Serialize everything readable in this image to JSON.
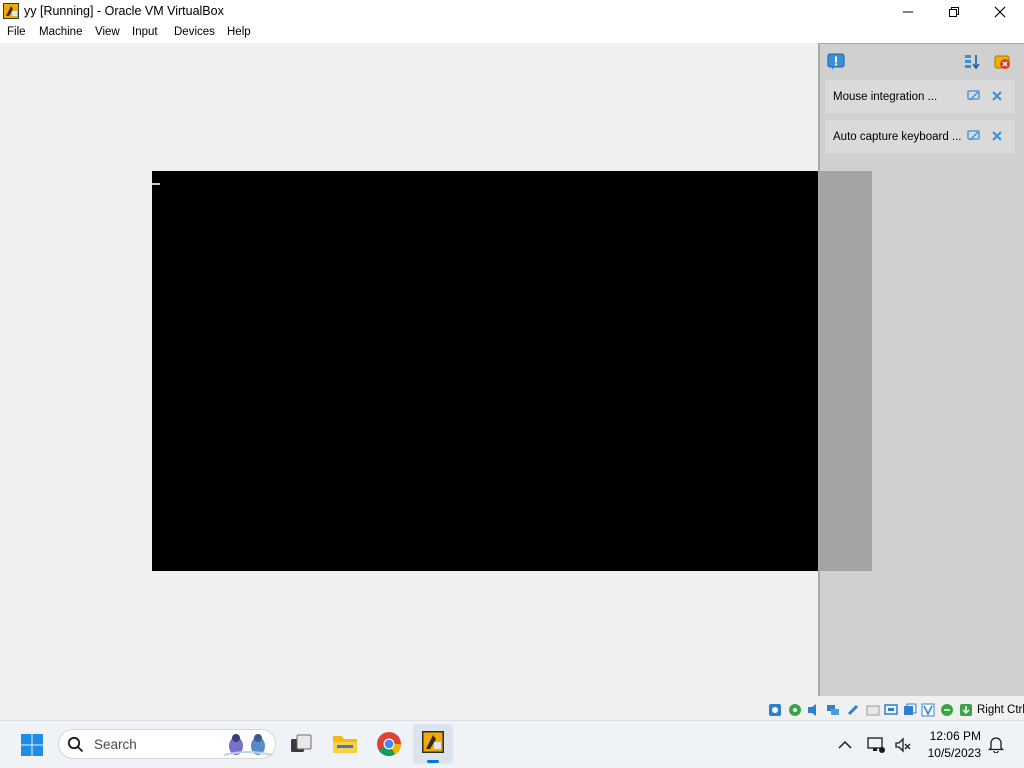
{
  "window": {
    "title": "yy [Running] - Oracle VM VirtualBox",
    "app_icon": "virtualbox-icon",
    "controls": [
      "minimize-icon",
      "maximize-icon",
      "close-icon"
    ]
  },
  "menubar": {
    "items": [
      "File",
      "Machine",
      "View",
      "Input",
      "Devices",
      "Help"
    ]
  },
  "notification_center": {
    "header_icon": "notification-center-icon",
    "header_actions": [
      "sort-notifications-icon",
      "clear-all-notifications-icon"
    ],
    "notifications": [
      {
        "label": "Mouse integration ...",
        "icons": [
          "do-not-show-again-icon",
          "close-notification-icon"
        ]
      },
      {
        "label": "Auto capture keyboard ...",
        "icons": [
          "do-not-show-again-icon",
          "close-notification-icon"
        ]
      }
    ]
  },
  "statusbar": {
    "icons": [
      "hard-disk-icon",
      "optical-drive-icon",
      "audio-icon",
      "network-icon",
      "usb-icon",
      "shared-folders-icon",
      "display-icon",
      "recording-icon",
      "vt-x-icon",
      "mouse-integration-icon",
      "keyboard-capture-icon"
    ],
    "host_key": "Right Ctrl"
  },
  "taskbar": {
    "search_placeholder": "Search",
    "apps": [
      "windows-start-icon",
      "task-view-icon",
      "file-explorer-icon",
      "chrome-icon",
      "virtualbox-taskbar-icon"
    ],
    "time": "12:06 PM",
    "date": "10/5/2023"
  },
  "colors": {
    "vm_screen": "#000000",
    "panel": "#c9c9c9",
    "accent": "#0078d4"
  }
}
